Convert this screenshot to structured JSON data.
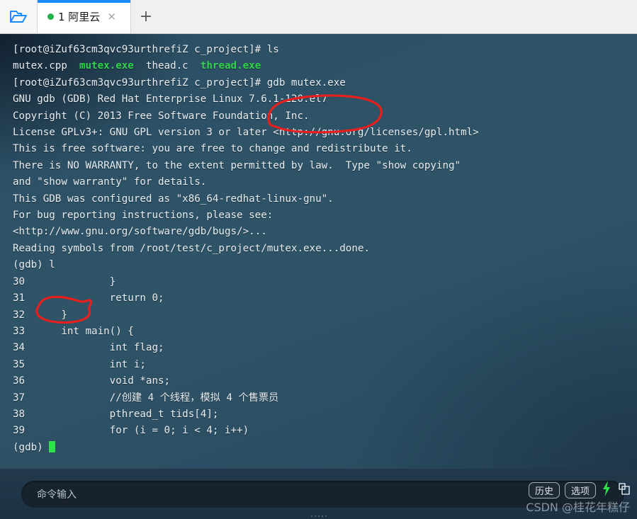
{
  "window": {
    "folder_icon": "open-folder-icon",
    "new_tab_label": "+"
  },
  "tabs": [
    {
      "title": "1 阿里云",
      "status_dot_color": "#22b14c",
      "close_label": "×",
      "active": true
    }
  ],
  "terminal": {
    "background_color": "#2f5468",
    "foreground_color": "#e8eef2",
    "exec_file_color": "#2fd44a",
    "cursor_color": "#2ee34a",
    "prompt": "[root@iZuf63cm3qvc93urthrefiZ c_project]#",
    "gdb_prompt": "(gdb)",
    "lines": [
      {
        "type": "plain",
        "text": "[root@iZuf63cm3qvc93urthrefiZ c_project]# ls"
      },
      {
        "type": "ls",
        "segments": [
          {
            "text": "mutex.cpp",
            "green": false
          },
          {
            "text": "  ",
            "green": false
          },
          {
            "text": "mutex.exe",
            "green": true
          },
          {
            "text": "  ",
            "green": false
          },
          {
            "text": "thead.c",
            "green": false
          },
          {
            "text": "  ",
            "green": false
          },
          {
            "text": "thread.exe",
            "green": true
          }
        ]
      },
      {
        "type": "plain",
        "text": "[root@iZuf63cm3qvc93urthrefiZ c_project]# gdb mutex.exe"
      },
      {
        "type": "plain",
        "text": "GNU gdb (GDB) Red Hat Enterprise Linux 7.6.1-120.el7"
      },
      {
        "type": "plain",
        "text": "Copyright (C) 2013 Free Software Foundation, Inc."
      },
      {
        "type": "plain",
        "text": "License GPLv3+: GNU GPL version 3 or later <http://gnu.org/licenses/gpl.html>"
      },
      {
        "type": "plain",
        "text": "This is free software: you are free to change and redistribute it."
      },
      {
        "type": "plain",
        "text": "There is NO WARRANTY, to the extent permitted by law.  Type \"show copying\""
      },
      {
        "type": "plain",
        "text": "and \"show warranty\" for details."
      },
      {
        "type": "plain",
        "text": "This GDB was configured as \"x86_64-redhat-linux-gnu\"."
      },
      {
        "type": "plain",
        "text": "For bug reporting instructions, please see:"
      },
      {
        "type": "plain",
        "text": "<http://www.gnu.org/software/gdb/bugs/>..."
      },
      {
        "type": "plain",
        "text": "Reading symbols from /root/test/c_project/mutex.exe...done."
      },
      {
        "type": "plain",
        "text": "(gdb) l"
      },
      {
        "type": "plain",
        "text": "30              }"
      },
      {
        "type": "plain",
        "text": "31              return 0;"
      },
      {
        "type": "plain",
        "text": "32      }"
      },
      {
        "type": "plain",
        "text": "33      int main() {"
      },
      {
        "type": "plain",
        "text": "34              int flag;"
      },
      {
        "type": "plain",
        "text": "35              int i;"
      },
      {
        "type": "plain",
        "text": "36              void *ans;"
      },
      {
        "type": "plain",
        "text": "37              //创建 4 个线程，模拟 4 个售票员"
      },
      {
        "type": "plain",
        "text": "38              pthread_t tids[4];"
      },
      {
        "type": "plain",
        "text": "39              for (i = 0; i < 4; i++)"
      },
      {
        "type": "cursor",
        "text": "(gdb) "
      }
    ],
    "annotations": [
      {
        "name": "circle-gdb-command",
        "shape": "ellipse",
        "color": "#e8201d",
        "target_text": "gdb mutex.exe"
      },
      {
        "name": "circle-list-command",
        "shape": "ellipse",
        "color": "#e8201d",
        "target_text": "l"
      }
    ]
  },
  "command_bar": {
    "input_placeholder": "命令输入",
    "buttons": [
      {
        "label": "历史",
        "name": "history-button"
      },
      {
        "label": "选项",
        "name": "options-button"
      }
    ],
    "bolt_icon": "lightning-bolt-icon",
    "bolt_color": "#2ee34a",
    "copy_icon": "copy-icon"
  },
  "watermark": {
    "text": "CSDN @桂花年糕仔"
  }
}
